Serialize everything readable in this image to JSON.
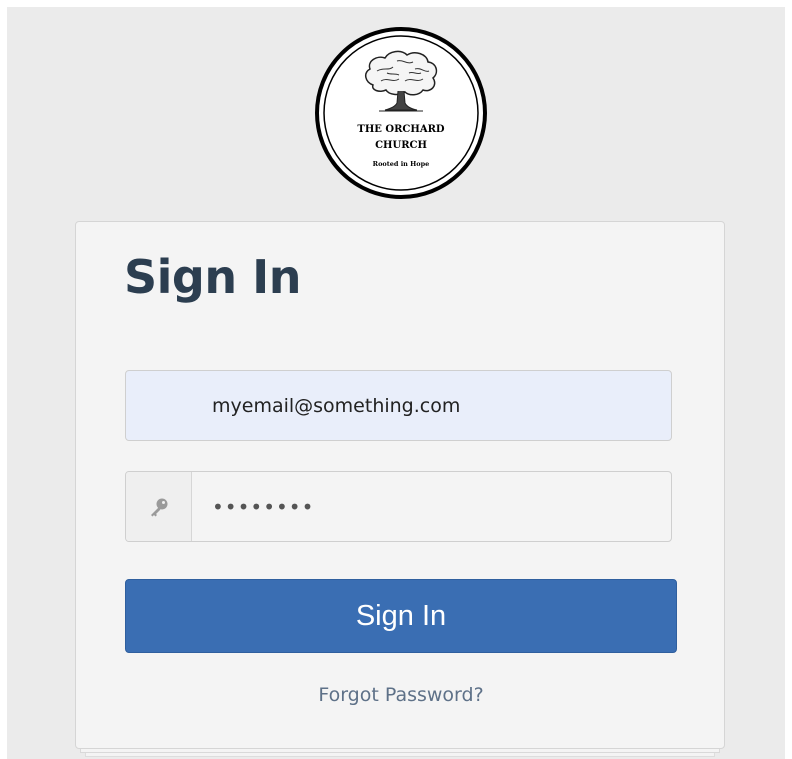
{
  "logo": {
    "line1": "THE ORCHARD",
    "line2": "CHURCH",
    "tagline": "Rooted in Hope",
    "icon": "oak-tree-icon"
  },
  "form": {
    "title": "Sign In",
    "email_value": "myemail@something.com",
    "password_value": "••••••••",
    "password_icon": "key-icon",
    "submit_label": "Sign In",
    "forgot_label": "Forgot Password?"
  },
  "colors": {
    "title": "#2c3e50",
    "button": "#3a6eb3",
    "email_field_bg": "#e9eefa",
    "link": "#5e7188",
    "page_bg": "#ebebeb",
    "card_bg": "#f4f4f4"
  }
}
